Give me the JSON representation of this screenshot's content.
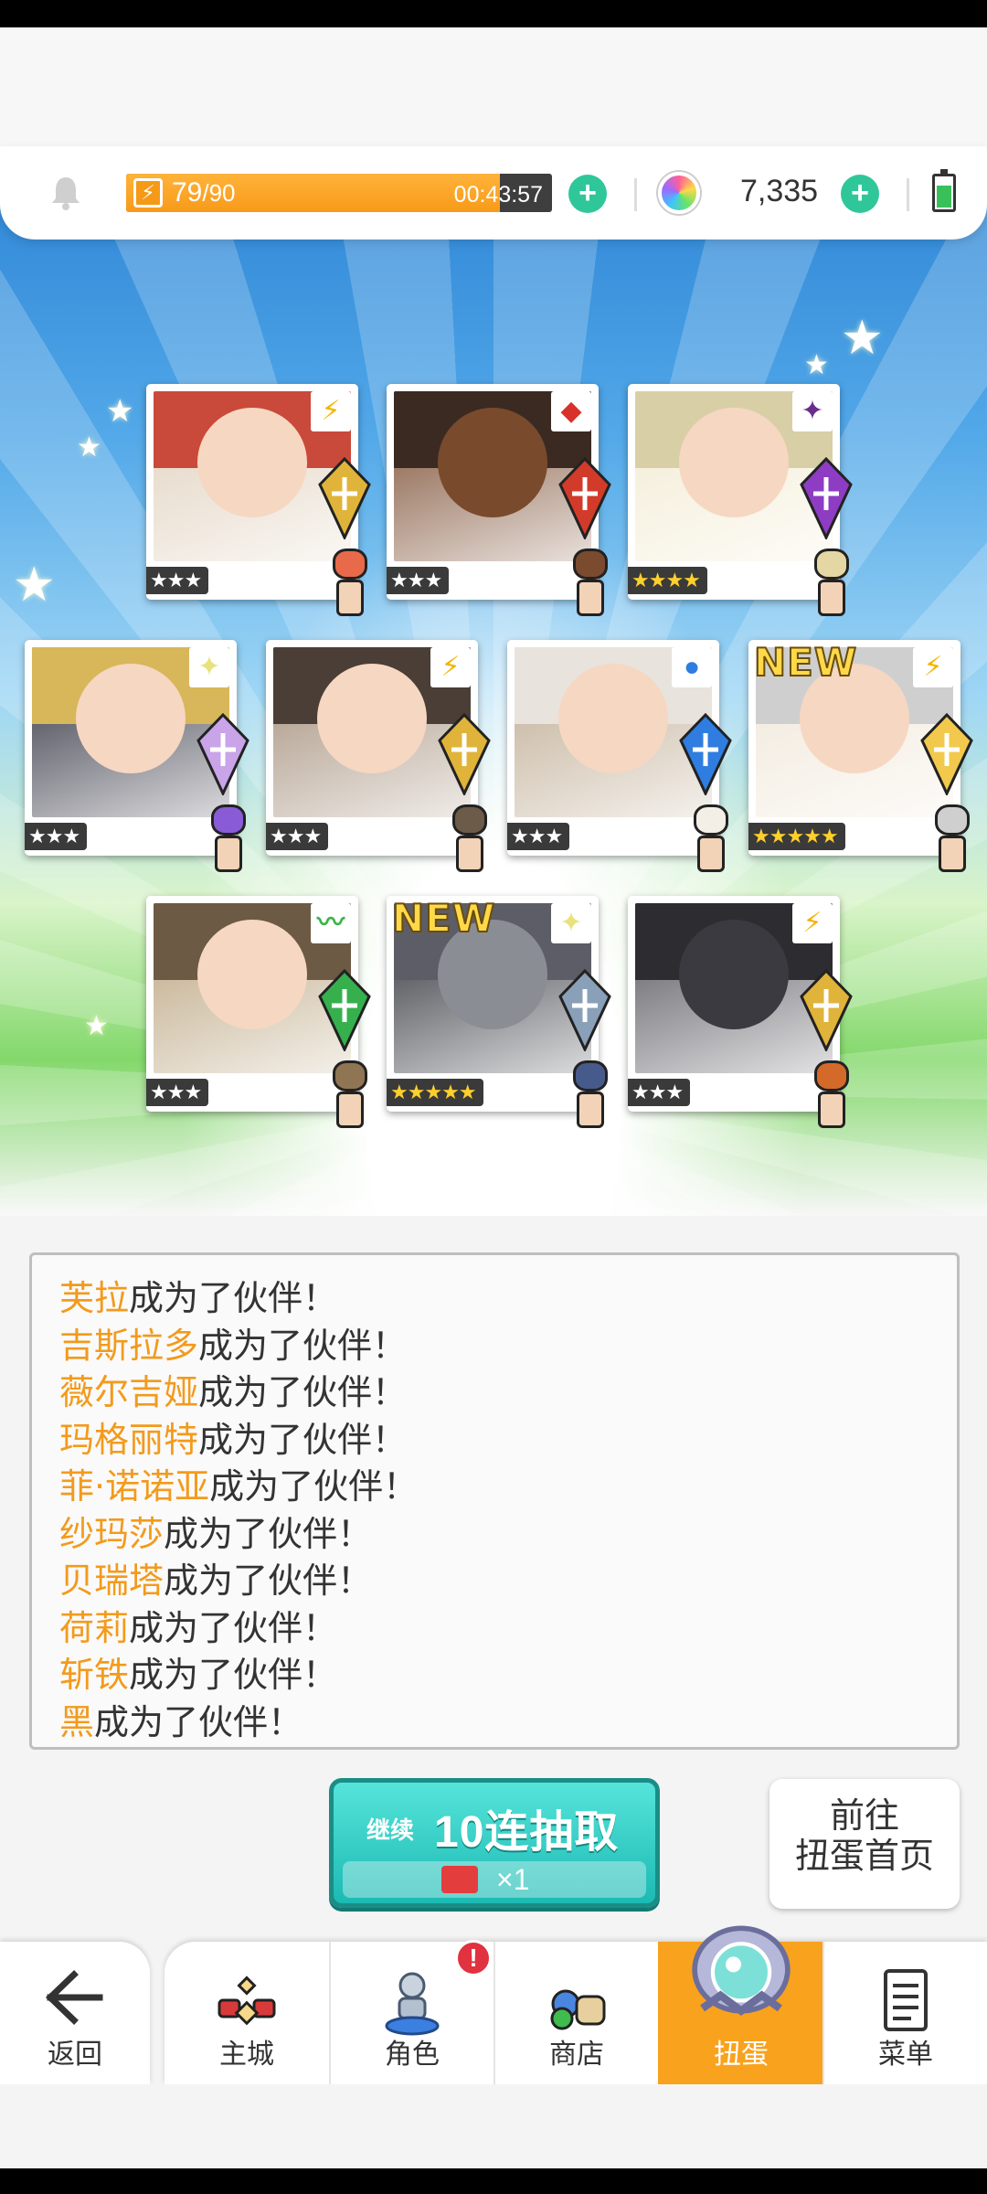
{
  "resources": {
    "energy_current": "79",
    "energy_max": "/90",
    "energy_fraction": 0.878,
    "energy_timer": "00:43:57",
    "gems": "7,335"
  },
  "cards": [
    {
      "name": "芙拉",
      "stars": "★★★",
      "element": "⚡",
      "element_color": "#f5b400",
      "is_new": false
    },
    {
      "name": "吉斯拉多",
      "stars": "★★★",
      "element": "◆",
      "element_color": "#d8312a",
      "is_new": false
    },
    {
      "name": "薇尔吉娅",
      "stars": "★★★★",
      "element": "✦",
      "element_color": "#6a2d8c",
      "is_new": false
    },
    {
      "name": "玛格丽特",
      "stars": "★★★",
      "element": "✦",
      "element_color": "#e7e27a",
      "is_new": false
    },
    {
      "name": "菲·诺诺亚",
      "stars": "★★★",
      "element": "⚡",
      "element_color": "#f5b400",
      "is_new": false
    },
    {
      "name": "纱玛莎",
      "stars": "★★★",
      "element": "●",
      "element_color": "#2f7de0",
      "is_new": false
    },
    {
      "name": "贝瑞塔",
      "stars": "★★★★★",
      "element": "⚡",
      "element_color": "#f5b400",
      "is_new": true,
      "new_label": "NEW"
    },
    {
      "name": "荷莉",
      "stars": "★★★",
      "element": "〰",
      "element_color": "#3cb54a",
      "is_new": false
    },
    {
      "name": "斩铁",
      "stars": "★★★★★",
      "element": "✦",
      "element_color": "#e7e27a",
      "is_new": true,
      "new_label": "NEW"
    },
    {
      "name": "黑",
      "stars": "★★★",
      "element": "⚡",
      "element_color": "#f5b400",
      "is_new": false
    }
  ],
  "log": {
    "suffix": "成为了伙伴！",
    "entries": [
      "芙拉",
      "吉斯拉多",
      "薇尔吉娅",
      "玛格丽特",
      "菲·诺诺亚",
      "纱玛莎",
      "贝瑞塔",
      "荷莉",
      "斩铁",
      "黑"
    ]
  },
  "actions": {
    "continue_label": "继续",
    "pull_label": "10连抽取",
    "pull_cost": "×1",
    "goto_line1": "前往",
    "goto_line2": "扭蛋首页"
  },
  "nav": {
    "back": "返回",
    "items": [
      {
        "label": "主城",
        "icon": "castle-icon"
      },
      {
        "label": "角色",
        "icon": "character-icon",
        "badge": "!"
      },
      {
        "label": "商店",
        "icon": "shop-icon"
      },
      {
        "label": "扭蛋",
        "icon": "gacha-icon",
        "active": true
      },
      {
        "label": "菜单",
        "icon": "menu-icon"
      }
    ]
  }
}
